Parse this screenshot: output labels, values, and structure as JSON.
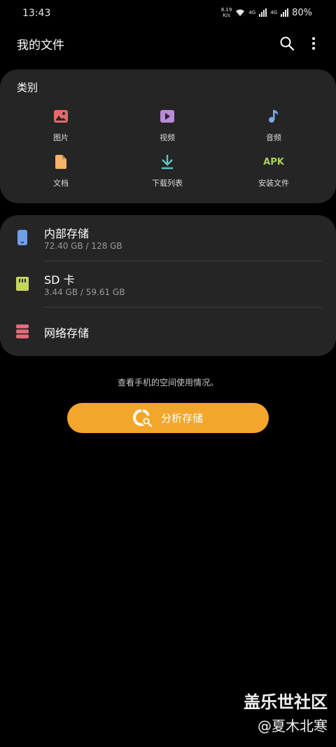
{
  "status_bar": {
    "time": "13:43",
    "net_speed_value": "8.19",
    "net_speed_unit": "K/s",
    "sim1_label": "4G",
    "sim2_label": "4G",
    "battery": "80%"
  },
  "header": {
    "title": "我的文件",
    "search_icon": "search-icon",
    "more_icon": "more-vertical-icon"
  },
  "categories": {
    "title": "类别",
    "items": [
      {
        "label": "图片",
        "icon": "image-icon",
        "color": "#e46a6a"
      },
      {
        "label": "视频",
        "icon": "video-icon",
        "color": "#b98bd8"
      },
      {
        "label": "音频",
        "icon": "music-icon",
        "color": "#7ba8ea"
      },
      {
        "label": "文档",
        "icon": "document-icon",
        "color": "#f4b46c"
      },
      {
        "label": "下载列表",
        "icon": "download-icon",
        "color": "#5cc6c2"
      },
      {
        "label": "安装文件",
        "icon": "apk-icon",
        "glyph": "APK",
        "color": "#a6d15a"
      }
    ]
  },
  "storage": {
    "items": [
      {
        "title": "内部存储",
        "subtitle": "72.40 GB / 128 GB",
        "icon": "phone-icon",
        "color": "#6f9eea"
      },
      {
        "title": "SD 卡",
        "subtitle": "3.44 GB / 59.61 GB",
        "icon": "sd-card-icon",
        "color": "#c6d65a"
      },
      {
        "title": "网络存储",
        "icon": "server-icon",
        "color": "#e86a7a"
      }
    ]
  },
  "hint": "查看手机的空间使用情况。",
  "analyze_button": {
    "label": "分析存储",
    "color": "#f3a62c",
    "icon": "analyze-storage-icon"
  },
  "watermark": {
    "line1": "盖乐世社区",
    "line2": "@夏木北寒"
  }
}
